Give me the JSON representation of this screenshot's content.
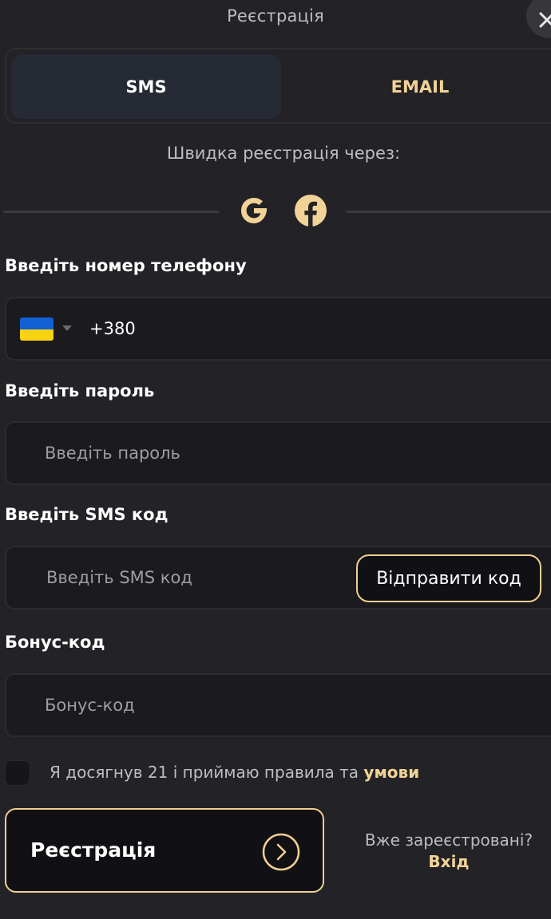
{
  "header": {
    "title": "Реєстрація",
    "close_icon": "close-icon"
  },
  "tabs": [
    {
      "label": "SMS",
      "active": true
    },
    {
      "label": "EMAIL",
      "active": false
    }
  ],
  "quick_signup": {
    "label": "Швидка реєстрація через:",
    "providers": [
      {
        "name": "Google",
        "icon": "google-icon"
      },
      {
        "name": "Facebook",
        "icon": "facebook-icon"
      }
    ]
  },
  "phone": {
    "label": "Введіть номер телефону",
    "country_flag": "ukraine-flag-icon",
    "value": "+380"
  },
  "password": {
    "label": "Введіть пароль",
    "placeholder": "Введіть пароль"
  },
  "sms_code": {
    "label": "Введіть SMS код",
    "placeholder": "Введіть SMS код",
    "send_button": "Відправити код"
  },
  "bonus": {
    "label": "Бонус-код",
    "placeholder": "Бонус-код"
  },
  "terms": {
    "checked": false,
    "text": "Я досягнув 21 і приймаю правила та ",
    "link": "умови"
  },
  "register": {
    "label": "Реєстрація",
    "arrow_icon": "chevron-right-circle-icon"
  },
  "login": {
    "prompt": "Вже зареєстровані?",
    "link": "Вхід"
  },
  "colors": {
    "background": "#232226",
    "accent": "#f2d397",
    "input_bg": "#1b1a1e",
    "active_tab": "#262a35"
  }
}
